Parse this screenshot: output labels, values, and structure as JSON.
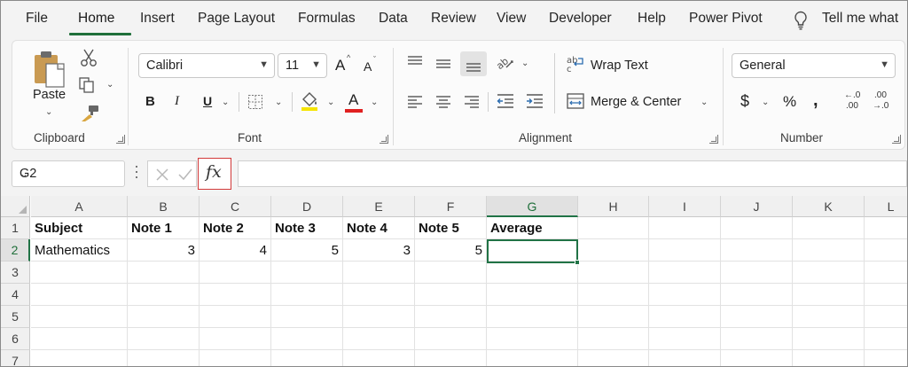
{
  "menu": {
    "tabs": [
      "File",
      "Home",
      "Insert",
      "Page Layout",
      "Formulas",
      "Data",
      "Review",
      "View",
      "Developer",
      "Help",
      "Power Pivot"
    ],
    "active_tab": "Home",
    "tell_me": "Tell me what"
  },
  "ribbon": {
    "clipboard": {
      "paste": "Paste",
      "label": "Clipboard"
    },
    "font": {
      "family": "Calibri",
      "size": "11",
      "grow": "A",
      "shrink": "A",
      "bold": "B",
      "italic": "I",
      "underline": "U",
      "color_letter": "A",
      "label": "Font"
    },
    "alignment": {
      "wrap_text": "Wrap Text",
      "merge_center": "Merge & Center",
      "label": "Alignment"
    },
    "number": {
      "format": "General",
      "currency": "$",
      "percent": "%",
      "comma": ",",
      "inc_dec": ".00",
      "inc_dec_small": "←.0",
      "dec_dec": ".00",
      "dec_dec_small": "→.0",
      "label": "Number"
    }
  },
  "formula_bar": {
    "name_box": "G2",
    "fx": "fx",
    "value": ""
  },
  "sheet": {
    "columns": [
      "A",
      "B",
      "C",
      "D",
      "E",
      "F",
      "G",
      "H",
      "I",
      "J",
      "K",
      "L"
    ],
    "selected_column": "G",
    "rows": [
      "1",
      "2",
      "3",
      "4",
      "5",
      "6",
      "7"
    ],
    "selected_row": "2",
    "header_row": [
      "Subject",
      "Note 1",
      "Note 2",
      "Note 3",
      "Note 4",
      "Note 5",
      "Average"
    ],
    "data_row": [
      "Mathematics",
      "3",
      "4",
      "5",
      "3",
      "5",
      ""
    ],
    "active_cell": "G2"
  },
  "colors": {
    "accent": "#217346",
    "highlight_border": "#d23a3a",
    "font_color_bar": "#e02020"
  }
}
